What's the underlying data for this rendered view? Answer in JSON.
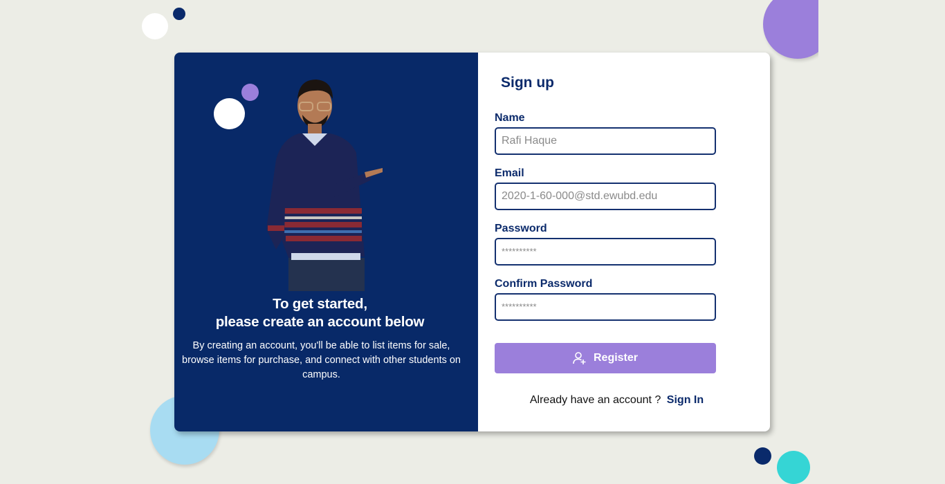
{
  "left_panel": {
    "headline_line1": "To get started,",
    "headline_line2": "please create an account below",
    "description": "By creating an account, you'll be able to list items for sale, browse items for purchase, and connect with other students on campus."
  },
  "form": {
    "title": "Sign up",
    "name": {
      "label": "Name",
      "placeholder": "Rafi Haque"
    },
    "email": {
      "label": "Email",
      "placeholder": "2020-1-60-000@std.ewubd.edu"
    },
    "password": {
      "label": "Password",
      "placeholder": "**********"
    },
    "confirm_password": {
      "label": "Confirm Password",
      "placeholder": "**********"
    },
    "register_button": {
      "label": "Register",
      "icon": "user-plus-icon"
    },
    "signin_prompt": "Already have an account ?",
    "signin_link": "Sign In"
  },
  "colors": {
    "navy": "#082968",
    "accent_purple": "#9b7fdb",
    "page_background": "#ecede6",
    "light_blue": "#a8dcf2",
    "teal": "#35d5d5"
  }
}
